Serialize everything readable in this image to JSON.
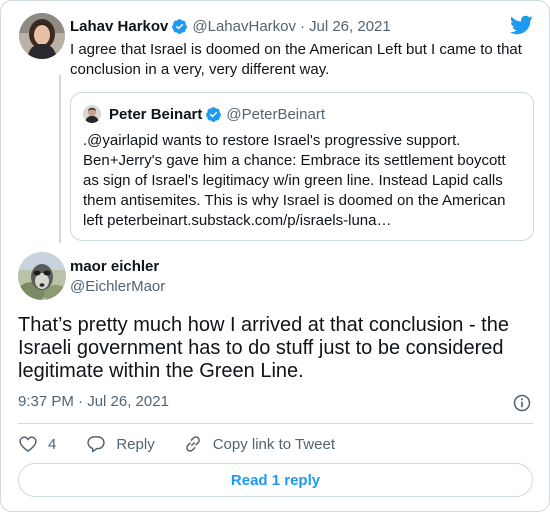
{
  "parent_tweet": {
    "author_name": "Lahav Harkov",
    "author_handle": "@LahavHarkov",
    "separator": "·",
    "date": "Jul 26, 2021",
    "text": "I agree that Israel is doomed on the American Left but I came to that conclusion in a very, very different way."
  },
  "quoted_tweet": {
    "author_name": "Peter Beinart",
    "author_handle": "@PeterBeinart",
    "text": ".@yairlapid wants to restore Israel's progressive support. Ben+Jerry's gave him a chance: Embrace its settlement boycott as sign of Israel's legitimacy w/in green line. Instead Lapid calls them antisemites. This is why Israel is doomed on the American left peterbeinart.substack.com/p/israels-luna…"
  },
  "main_tweet": {
    "author_name": "maor eichler",
    "author_handle": "@EichlerMaor",
    "text": "That’s pretty much how I arrived at that conclusion - the Israeli government has to do stuff just to be considered legitimate within the Green Line.",
    "timestamp": "9:37 PM · Jul 26, 2021"
  },
  "actions": {
    "like_count": "4",
    "reply_label": "Reply",
    "copy_link_label": "Copy link to Tweet"
  },
  "read_replies_label": "Read 1 reply",
  "colors": {
    "brand_blue": "#1d9bf0",
    "text_primary": "#0f1419",
    "text_secondary": "#536471",
    "border": "#cfd9de"
  },
  "icons": [
    "verified-badge-icon",
    "twitter-bird-icon",
    "info-icon",
    "heart-icon",
    "reply-bubble-icon",
    "link-icon"
  ]
}
